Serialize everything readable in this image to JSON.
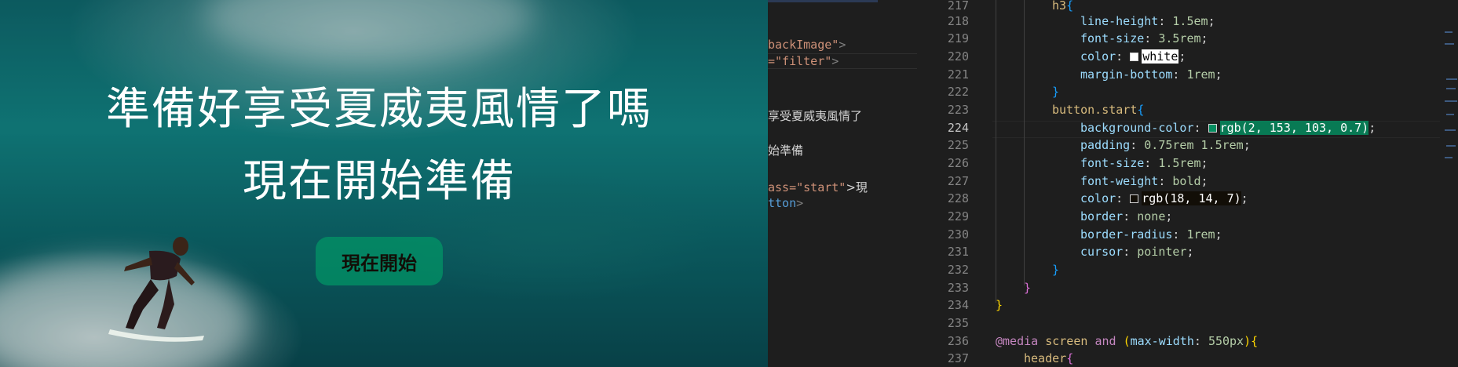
{
  "preview": {
    "hero_line1": "準備好享受夏威夷風情了嗎",
    "hero_line2": "現在開始準備",
    "start_button_label": "現在開始"
  },
  "html_editor": {
    "lines": [
      {
        "a": "backImage\"",
        "b": ">"
      },
      {
        "a": "=\"filter\"",
        "b": ">"
      },
      {
        "a": "享受夏威夷風情了",
        "b": ""
      },
      {
        "a": "始準備",
        "b": ""
      },
      {
        "a": "ass=\"start\"",
        "b": ">現"
      },
      {
        "a": "tton",
        "b": ">"
      }
    ]
  },
  "css_editor": {
    "active_line": "224",
    "line_numbers": [
      "217",
      "218",
      "219",
      "220",
      "221",
      "222",
      "223",
      "224",
      "225",
      "226",
      "227",
      "228",
      "229",
      "230",
      "231",
      "232",
      "233",
      "234",
      "235",
      "236",
      "237"
    ],
    "l217_selector": "h3",
    "l217_brace": "{",
    "l218_prop": "line-height",
    "l218_val": "1.5em",
    "l219_prop": "font-size",
    "l219_val": "3.5rem",
    "l220_prop": "color",
    "l220_val": "white",
    "l221_prop": "margin-bottom",
    "l221_val": "1rem",
    "l222_brace": "}",
    "l223_selector": "button.start",
    "l223_brace": "{",
    "l224_prop": "background-color",
    "l224_val": "rgb(2, 153, 103, 0.7)",
    "l225_prop": "padding",
    "l225_val": "0.75rem 1.5rem",
    "l226_prop": "font-size",
    "l226_val": "1.5rem",
    "l227_prop": "font-weight",
    "l227_val": "bold",
    "l228_prop": "color",
    "l228_val": "rgb(18, 14, 7)",
    "l229_prop": "border",
    "l229_val": "none",
    "l230_prop": "border-radius",
    "l230_val": "1rem",
    "l231_prop": "cursor",
    "l231_val": "pointer",
    "l232_brace": "}",
    "l233_brace": "}",
    "l234_brace": "}",
    "l236_at": "@media",
    "l236_screen": "screen",
    "l236_and": "and",
    "l236_open": "(",
    "l236_feature": "max-width",
    "l236_value": "550px",
    "l236_close": ")",
    "l236_brace": "{",
    "l237_selector": "header",
    "l237_brace": "{"
  },
  "colors": {
    "editor_bg": "#1e1e1e",
    "button_bg": "rgba(2,153,103,0.7)",
    "property": "#9cdcfe",
    "number": "#b5cea8",
    "selector": "#d7ba7d"
  }
}
